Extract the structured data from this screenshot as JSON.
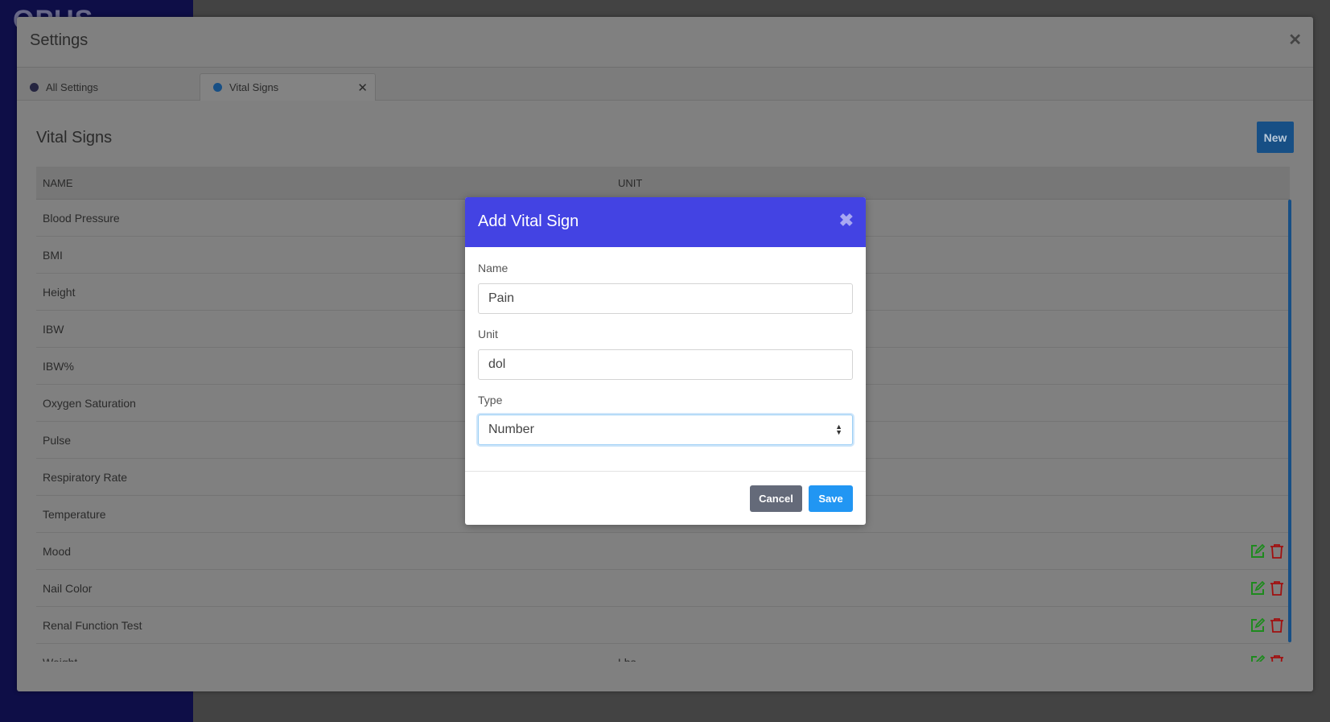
{
  "app": {
    "logo": "OPUS"
  },
  "window": {
    "title": "Settings",
    "close_icon": "close-icon"
  },
  "tabs": [
    {
      "label": "All Settings"
    },
    {
      "label": "Vital Signs",
      "active": true
    }
  ],
  "page": {
    "title": "Vital Signs",
    "new_label": "New"
  },
  "table": {
    "headers": [
      "NAME",
      "UNIT"
    ],
    "rows": [
      {
        "name": "Blood Pressure",
        "unit": ""
      },
      {
        "name": "BMI",
        "unit": ""
      },
      {
        "name": "Height",
        "unit": ""
      },
      {
        "name": "IBW",
        "unit": ""
      },
      {
        "name": "IBW%",
        "unit": ""
      },
      {
        "name": "Oxygen Saturation",
        "unit": ""
      },
      {
        "name": "Pulse",
        "unit": ""
      },
      {
        "name": "Respiratory Rate",
        "unit": ""
      },
      {
        "name": "Temperature",
        "unit": ""
      },
      {
        "name": "Mood",
        "unit": "",
        "actions": true
      },
      {
        "name": "Nail Color",
        "unit": "",
        "actions": true
      },
      {
        "name": "Renal Function Test",
        "unit": "",
        "actions": true
      },
      {
        "name": "Weight",
        "unit": "Lbs",
        "actions": true
      }
    ]
  },
  "modal": {
    "title": "Add Vital Sign",
    "name_label": "Name",
    "name_value": "Pain",
    "unit_label": "Unit",
    "unit_value": "dol",
    "type_label": "Type",
    "type_value": "Number",
    "cancel_label": "Cancel",
    "save_label": "Save"
  },
  "colors": {
    "modal_header": "#4343e3",
    "save": "#2196f3",
    "cancel": "#646a79",
    "edit": "#1e8a1e",
    "delete": "#a01010",
    "sidebar": "#0e0e47"
  }
}
